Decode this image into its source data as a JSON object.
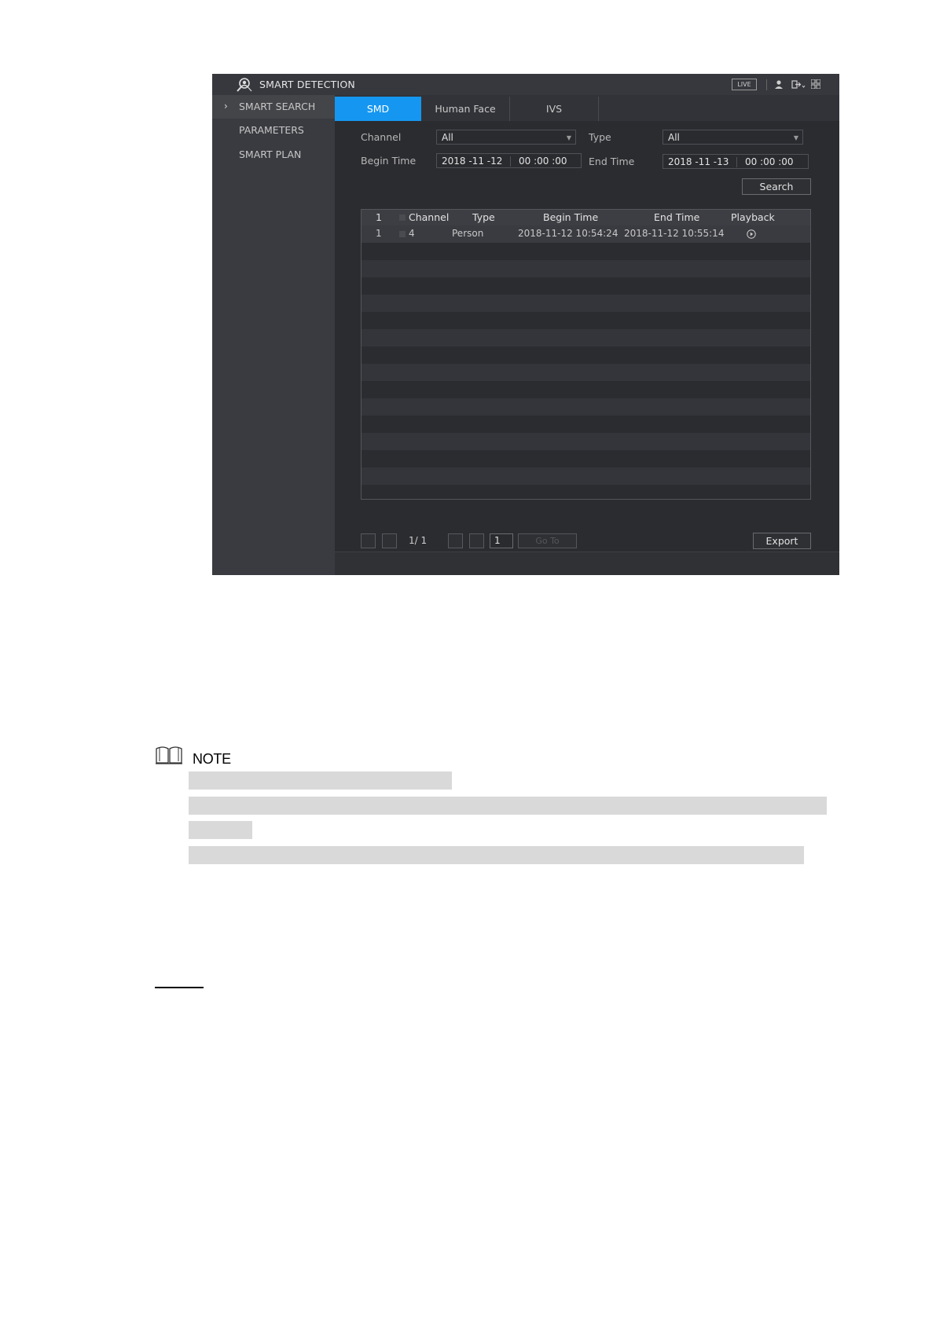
{
  "app": {
    "title": "SMART DETECTION",
    "live_badge": "LIVE"
  },
  "sidebar": {
    "items": [
      {
        "label": "SMART SEARCH",
        "active": true,
        "arrow": "›"
      },
      {
        "label": "PARAMETERS",
        "active": false
      },
      {
        "label": "SMART PLAN",
        "active": false
      }
    ]
  },
  "tabs": [
    {
      "label": "SMD",
      "active": true
    },
    {
      "label": "Human Face",
      "active": false
    },
    {
      "label": "IVS",
      "active": false
    }
  ],
  "filters": {
    "channel_label": "Channel",
    "channel_value": "All",
    "type_label": "Type",
    "type_value": "All",
    "begin_label": "Begin Time",
    "begin_date": "2018 -11 -12",
    "begin_time": "00 :00 :00",
    "end_label": "End Time",
    "end_date": "2018 -11 -13",
    "end_time": "00 :00 :00",
    "search_button": "Search"
  },
  "table": {
    "headers": {
      "index": "1",
      "channel": "Channel",
      "type": "Type",
      "begin": "Begin Time",
      "end": "End Time",
      "playback": "Playback"
    },
    "rows": [
      {
        "index": "1",
        "channel": "4",
        "type": "Person",
        "begin": "2018-11-12 10:54:24",
        "end": "2018-11-12 10:55:14"
      }
    ]
  },
  "pagination": {
    "page_text": "1/  1",
    "page_input": "1",
    "goto_label": "Go To",
    "export_button": "Export"
  },
  "note": {
    "label": "NOTE"
  },
  "colors": {
    "accent": "#1597f1",
    "background": "#2b2c30",
    "redaction": "#d9d9d9"
  }
}
